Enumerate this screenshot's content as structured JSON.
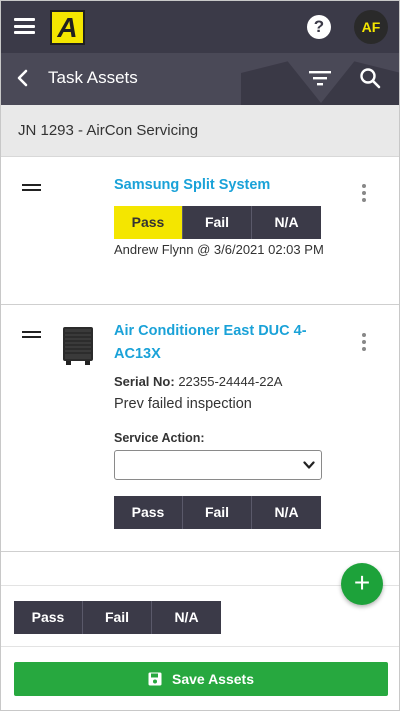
{
  "app": {
    "logo_letter": "A",
    "help_label": "?",
    "user_initials": "AF"
  },
  "header": {
    "title": "Task Assets"
  },
  "job": {
    "title": "JN 1293 - AirCon Servicing"
  },
  "assets": [
    {
      "name": "Samsung Split System",
      "status_options": [
        "Pass",
        "Fail",
        "N/A"
      ],
      "selected": "Pass",
      "inspection_by": "Andrew Flynn @ 3/6/2021 02:03",
      "inspection_time_suffix": "PM"
    },
    {
      "name_line1": "Air Conditioner East DUC 4-",
      "name_line2": "AC13X",
      "serial_label": "Serial No:",
      "serial_value": "22355-24444-22A",
      "note": "Prev failed inspection",
      "service_action_label": "Service Action:",
      "service_action_value": "",
      "status_options": [
        "Pass",
        "Fail",
        "N/A"
      ]
    }
  ],
  "bulk_actions": [
    "Pass",
    "Fail",
    "N/A"
  ],
  "fab_label": "+",
  "save_label": "Save Assets",
  "colors": {
    "topbar": "#3b3a48",
    "subbar": "#4a4957",
    "accent_yellow": "#f4e600",
    "link_blue": "#1aa2d8",
    "save_green": "#27a83f"
  }
}
